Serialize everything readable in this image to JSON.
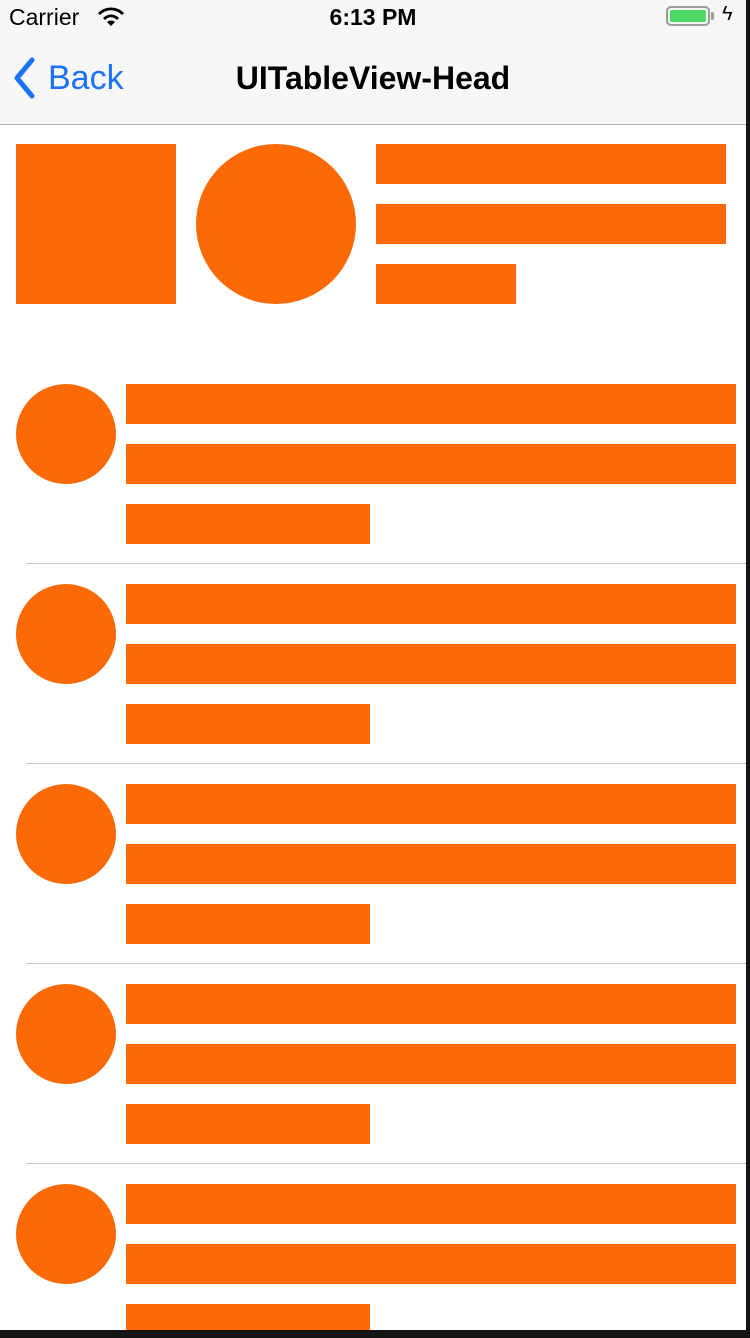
{
  "status_bar": {
    "carrier": "Carrier",
    "time": "6:13 PM",
    "battery_level": 1.0,
    "charging": true
  },
  "nav": {
    "back_label": "Back",
    "title": "UITableView-Head"
  },
  "colors": {
    "placeholder": "#fc6a08",
    "accent": "#1a73f5",
    "battery": "#4cd964"
  },
  "icons": {
    "wifi": "wifi-icon",
    "back": "chevron-left-icon",
    "battery": "battery-icon",
    "bolt": "charging-bolt-icon"
  }
}
